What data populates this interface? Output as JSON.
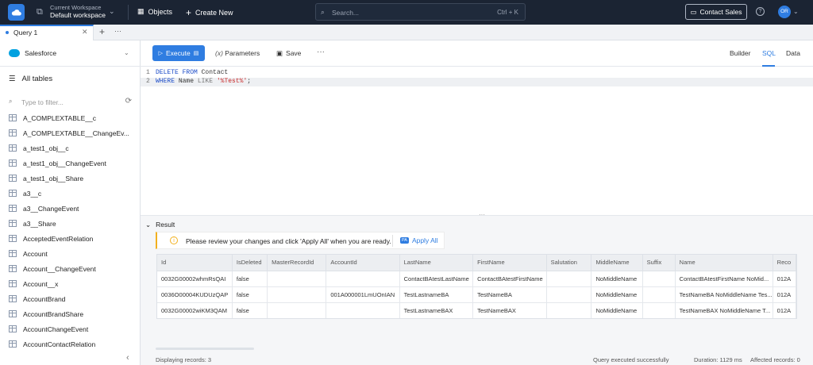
{
  "topbar": {
    "workspace_label": "Current Workspace",
    "workspace_name": "Default workspace",
    "objects": "Objects",
    "create_new": "Create New",
    "search_placeholder": "Search...",
    "search_shortcut": "Ctrl + K",
    "contact_sales": "Contact Sales",
    "avatar_initials": "OR"
  },
  "tabs": [
    {
      "label": "Query 1"
    }
  ],
  "left": {
    "connection": "Salesforce",
    "all_tables": "All tables",
    "filter_placeholder": "Type to filter...",
    "tables": [
      "A_COMPLEXTABLE__c",
      "A_COMPLEXTABLE__ChangeEv...",
      "a_test1_obj__c",
      "a_test1_obj__ChangeEvent",
      "a_test1_obj__Share",
      "a3__c",
      "a3__ChangeEvent",
      "a3__Share",
      "AcceptedEventRelation",
      "Account",
      "Account__ChangeEvent",
      "Account__x",
      "AccountBrand",
      "AccountBrandShare",
      "AccountChangeEvent",
      "AccountContactRelation"
    ]
  },
  "toolbar": {
    "execute": "Execute",
    "parameters": "Parameters",
    "save": "Save",
    "views": [
      "Builder",
      "SQL",
      "Data"
    ],
    "active_view": "SQL"
  },
  "editor": {
    "lines": [
      {
        "num": "1",
        "tokens": [
          {
            "t": "kw",
            "v": "DELETE"
          },
          {
            "t": "tx",
            "v": " "
          },
          {
            "t": "kw",
            "v": "FROM"
          },
          {
            "t": "tx",
            "v": " Contact"
          }
        ]
      },
      {
        "num": "2",
        "tokens": [
          {
            "t": "kw",
            "v": "WHERE"
          },
          {
            "t": "tx",
            "v": " Name "
          },
          {
            "t": "op",
            "v": "LIKE"
          },
          {
            "t": "tx",
            "v": " "
          },
          {
            "t": "str",
            "v": "'%Test%'"
          },
          {
            "t": "tx",
            "v": ";"
          }
        ]
      }
    ]
  },
  "result": {
    "title": "Result",
    "notice": "Please review your changes and click 'Apply All' when you are ready.",
    "apply_all": "Apply All",
    "columns": [
      "Id",
      "IsDeleted",
      "MasterRecordId",
      "AccountId",
      "LastName",
      "FirstName",
      "Salutation",
      "MiddleName",
      "Suffix",
      "Name",
      "Reco"
    ],
    "rows": [
      [
        "0032G00002whmRsQAI",
        "false",
        "",
        "",
        "ContactBAtestLastName",
        "ContactBAtestFirstName",
        "",
        "NoMiddleName",
        "",
        "ContactBAtestFirstName NoMid...",
        "012A"
      ],
      [
        "0036O00004KUDUzQAP",
        "false",
        "",
        "001A000001LmUOnIAN",
        "TestLastnameBA",
        "TestNameBA",
        "",
        "NoMiddleName",
        "",
        "TestNameBA NoMiddleName Tes...",
        "012A"
      ],
      [
        "0032G00002wiKM3QAM",
        "false",
        "",
        "",
        "TestLastnameBAX",
        "TestNameBAX",
        "",
        "NoMiddleName",
        "",
        "TestNameBAX NoMiddleName T...",
        "012A"
      ]
    ],
    "displaying": "Displaying records: 3",
    "status": "Query executed successfully",
    "duration": "Duration: 1129 ms",
    "affected": "Affected records: 0"
  }
}
